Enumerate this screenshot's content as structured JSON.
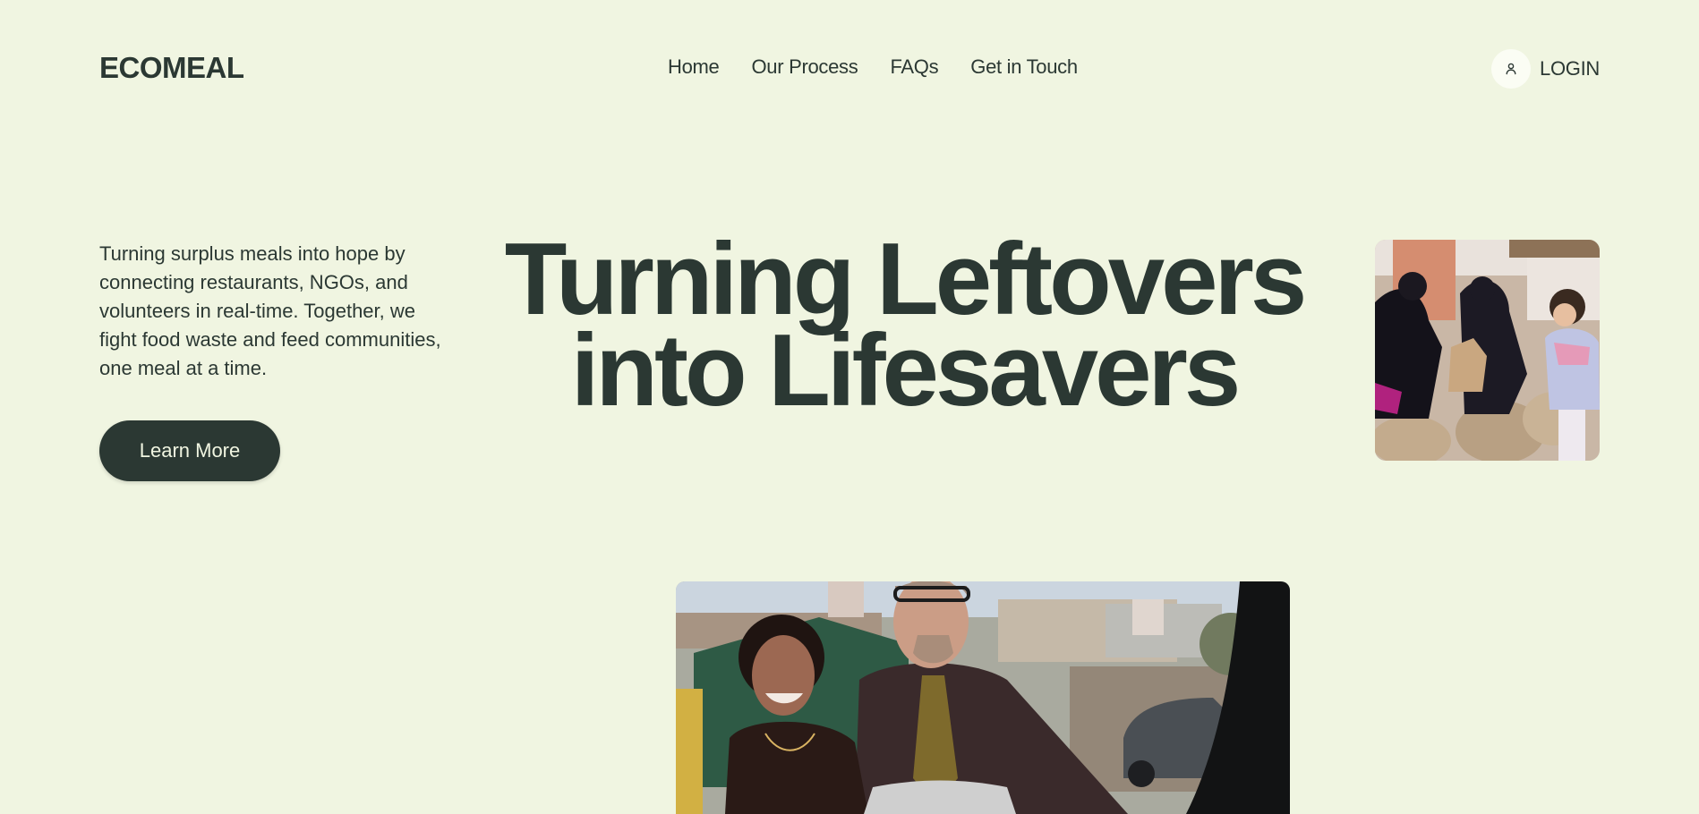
{
  "header": {
    "logo": "ECOMEAL",
    "nav": [
      "Home",
      "Our Process",
      "FAQs",
      "Get in Touch"
    ],
    "login_label": "LOGIN",
    "login_icon": "user-icon"
  },
  "hero": {
    "description": "Turning surplus meals into hope by connecting restaurants, NGOs, and volunteers in real-time. Together, we fight food waste and feed communities, one meal at a time.",
    "cta_label": "Learn More",
    "headline_line1": "Turning Leftovers",
    "headline_line2": "into Lifesavers"
  },
  "colors": {
    "background": "#f0f5e1",
    "primary": "#2b3833",
    "button_text": "#f0f5e1"
  }
}
